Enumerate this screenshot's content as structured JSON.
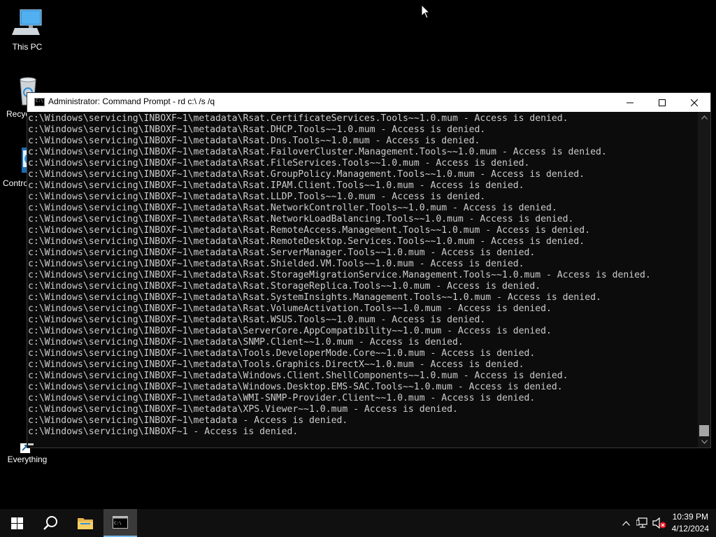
{
  "desktop": {
    "icons": [
      {
        "label": "This PC"
      },
      {
        "label": "Recyc"
      },
      {
        "label": "Contro"
      },
      {
        "label": "Everything"
      }
    ]
  },
  "window": {
    "title": "Administrator: Command Prompt - rd  c:\\ /s /q"
  },
  "console": {
    "lines": [
      "c:\\Windows\\servicing\\INBOXF~1\\metadata\\Rsat.CertificateServices.Tools~~1.0.mum - Access is denied.",
      "c:\\Windows\\servicing\\INBOXF~1\\metadata\\Rsat.DHCP.Tools~~1.0.mum - Access is denied.",
      "c:\\Windows\\servicing\\INBOXF~1\\metadata\\Rsat.Dns.Tools~~1.0.mum - Access is denied.",
      "c:\\Windows\\servicing\\INBOXF~1\\metadata\\Rsat.FailoverCluster.Management.Tools~~1.0.mum - Access is denied.",
      "c:\\Windows\\servicing\\INBOXF~1\\metadata\\Rsat.FileServices.Tools~~1.0.mum - Access is denied.",
      "c:\\Windows\\servicing\\INBOXF~1\\metadata\\Rsat.GroupPolicy.Management.Tools~~1.0.mum - Access is denied.",
      "c:\\Windows\\servicing\\INBOXF~1\\metadata\\Rsat.IPAM.Client.Tools~~1.0.mum - Access is denied.",
      "c:\\Windows\\servicing\\INBOXF~1\\metadata\\Rsat.LLDP.Tools~~1.0.mum - Access is denied.",
      "c:\\Windows\\servicing\\INBOXF~1\\metadata\\Rsat.NetworkController.Tools~~1.0.mum - Access is denied.",
      "c:\\Windows\\servicing\\INBOXF~1\\metadata\\Rsat.NetworkLoadBalancing.Tools~~1.0.mum - Access is denied.",
      "c:\\Windows\\servicing\\INBOXF~1\\metadata\\Rsat.RemoteAccess.Management.Tools~~1.0.mum - Access is denied.",
      "c:\\Windows\\servicing\\INBOXF~1\\metadata\\Rsat.RemoteDesktop.Services.Tools~~1.0.mum - Access is denied.",
      "c:\\Windows\\servicing\\INBOXF~1\\metadata\\Rsat.ServerManager.Tools~~1.0.mum - Access is denied.",
      "c:\\Windows\\servicing\\INBOXF~1\\metadata\\Rsat.Shielded.VM.Tools~~1.0.mum - Access is denied.",
      "c:\\Windows\\servicing\\INBOXF~1\\metadata\\Rsat.StorageMigrationService.Management.Tools~~1.0.mum - Access is denied.",
      "c:\\Windows\\servicing\\INBOXF~1\\metadata\\Rsat.StorageReplica.Tools~~1.0.mum - Access is denied.",
      "c:\\Windows\\servicing\\INBOXF~1\\metadata\\Rsat.SystemInsights.Management.Tools~~1.0.mum - Access is denied.",
      "c:\\Windows\\servicing\\INBOXF~1\\metadata\\Rsat.VolumeActivation.Tools~~1.0.mum - Access is denied.",
      "c:\\Windows\\servicing\\INBOXF~1\\metadata\\Rsat.WSUS.Tools~~1.0.mum - Access is denied.",
      "c:\\Windows\\servicing\\INBOXF~1\\metadata\\ServerCore.AppCompatibility~~1.0.mum - Access is denied.",
      "c:\\Windows\\servicing\\INBOXF~1\\metadata\\SNMP.Client~~1.0.mum - Access is denied.",
      "c:\\Windows\\servicing\\INBOXF~1\\metadata\\Tools.DeveloperMode.Core~~1.0.mum - Access is denied.",
      "c:\\Windows\\servicing\\INBOXF~1\\metadata\\Tools.Graphics.DirectX~~1.0.mum - Access is denied.",
      "c:\\Windows\\servicing\\INBOXF~1\\metadata\\Windows.Client.ShellComponents~~1.0.mum - Access is denied.",
      "c:\\Windows\\servicing\\INBOXF~1\\metadata\\Windows.Desktop.EMS-SAC.Tools~~1.0.mum - Access is denied.",
      "c:\\Windows\\servicing\\INBOXF~1\\metadata\\WMI-SNMP-Provider.Client~~1.0.mum - Access is denied.",
      "c:\\Windows\\servicing\\INBOXF~1\\metadata\\XPS.Viewer~~1.0.mum - Access is denied.",
      "c:\\Windows\\servicing\\INBOXF~1\\metadata - Access is denied.",
      "c:\\Windows\\servicing\\INBOXF~1 - Access is denied."
    ]
  },
  "taskbar": {
    "time": "10:39 PM",
    "date": "4/12/2024"
  }
}
